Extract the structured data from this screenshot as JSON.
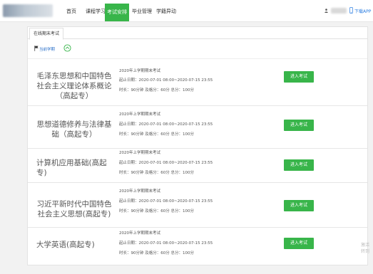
{
  "nav": {
    "items": [
      {
        "label": "首页",
        "active": false
      },
      {
        "label": "课程学习",
        "active": false
      },
      {
        "label": "考试安排",
        "active": true
      },
      {
        "label": "毕业管理",
        "active": false
      },
      {
        "label": "学籍异动",
        "active": false
      }
    ],
    "download_label": "下载APP",
    "accent_color": "#38b54a"
  },
  "tab": {
    "label": "在线期末考试"
  },
  "term": {
    "label": "当前学期"
  },
  "courses": [
    {
      "title": "毛泽东思想和中国特色社会主义理论体系概论（高起专）",
      "exam_name": "2020年上学期期末考试",
      "period": "起止日期：2020-07-01 08:00~2020-07-15 23:55",
      "meta": "时长：90分钟   及格分：60分   总分：100分",
      "button": "进入考试"
    },
    {
      "title": "思想道德修养与法律基础（高起专）",
      "exam_name": "2020年上学期期末考试",
      "period": "起止日期：2020-07-01 08:00~2020-07-15 23:55",
      "meta": "时长：90分钟   及格分：60分   总分：100分",
      "button": "进入考试"
    },
    {
      "title": "计算机应用基础(高起专)",
      "exam_name": "2020年上学期期末考试",
      "period": "起止日期：2020-07-01 08:00~2020-07-15 23:55",
      "meta": "时长：90分钟   及格分：60分   总分：100分",
      "button": "进入考试"
    },
    {
      "title": "习近平新时代中国特色社会主义思想(高起专)",
      "exam_name": "2020年上学期期末考试",
      "period": "起止日期：2020-07-01 08:00~2020-07-15 23:55",
      "meta": "时长：90分钟   及格分：60分   总分：100分",
      "button": "进入考试"
    },
    {
      "title": "大学英语(高起专)",
      "exam_name": "2020年上学期期末考试",
      "period": "起止日期：2020-07-01 08:00~2020-07-15 23:55",
      "meta": "时长：90分钟   及格分：60分   总分：100分",
      "button": "进入考试"
    }
  ],
  "watermark": {
    "text": "激活 转到"
  }
}
